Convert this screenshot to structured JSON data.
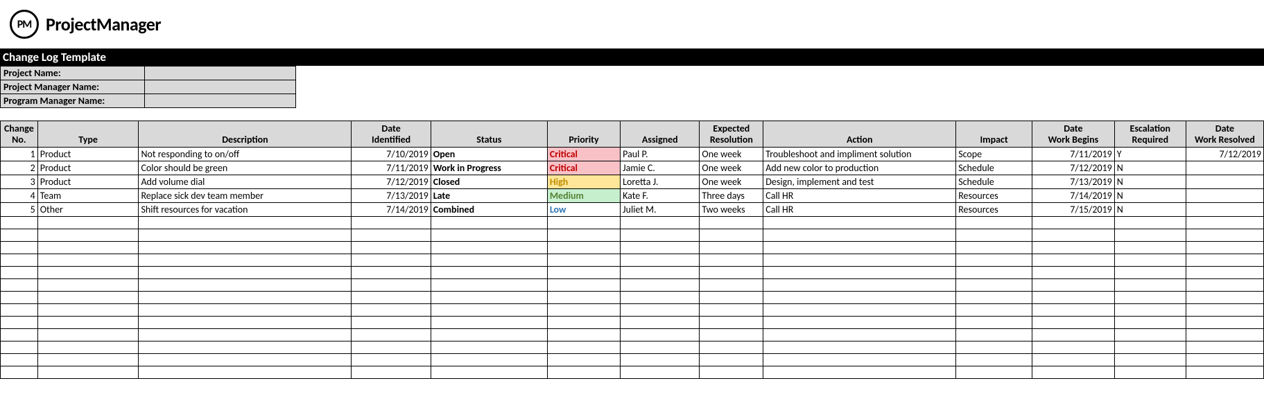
{
  "logo": {
    "badge": "PM",
    "text": "ProjectManager"
  },
  "titleBar": "Change Log Template",
  "meta": [
    {
      "label": "Project Name:",
      "value": ""
    },
    {
      "label": "Project Manager Name:",
      "value": ""
    },
    {
      "label": "Program Manager Name:",
      "value": ""
    }
  ],
  "columns": [
    "Change No.",
    "Type",
    "Description",
    "Date Identified",
    "Status",
    "Priority",
    "Assigned",
    "Expected Resolution",
    "Action",
    "Impact",
    "Date Work Begins",
    "Escalation Required",
    "Date Work Resolved"
  ],
  "rows": [
    {
      "no": "1",
      "type": "Product",
      "desc": "Not responding to on/off",
      "dateId": "7/10/2019",
      "status": "Open",
      "priority": "Critical",
      "assigned": "Paul P.",
      "expRes": "One week",
      "action": "Troubleshoot and impliment solution",
      "impact": "Scope",
      "dwb": "7/11/2019",
      "esc": "Y",
      "dwr": "7/12/2019"
    },
    {
      "no": "2",
      "type": "Product",
      "desc": "Color should be green",
      "dateId": "7/11/2019",
      "status": "Work in Progress",
      "priority": "Critical",
      "assigned": "Jamie C.",
      "expRes": "One week",
      "action": "Add new color to production",
      "impact": "Schedule",
      "dwb": "7/12/2019",
      "esc": "N",
      "dwr": ""
    },
    {
      "no": "3",
      "type": "Product",
      "desc": "Add volume dial",
      "dateId": "7/12/2019",
      "status": "Closed",
      "priority": "High",
      "assigned": "Loretta J.",
      "expRes": "One week",
      "action": "Design, implement and test",
      "impact": "Schedule",
      "dwb": "7/13/2019",
      "esc": "N",
      "dwr": ""
    },
    {
      "no": "4",
      "type": "Team",
      "desc": "Replace sick dev team member",
      "dateId": "7/13/2019",
      "status": "Late",
      "priority": "Medium",
      "assigned": "Kate F.",
      "expRes": "Three days",
      "action": "Call HR",
      "impact": "Resources",
      "dwb": "7/14/2019",
      "esc": "N",
      "dwr": ""
    },
    {
      "no": "5",
      "type": "Other",
      "desc": "Shift resources for vacation",
      "dateId": "7/14/2019",
      "status": "Combined",
      "priority": "Low",
      "assigned": "Juliet M.",
      "expRes": "Two weeks",
      "action": "Call HR",
      "impact": "Resources",
      "dwb": "7/15/2019",
      "esc": "N",
      "dwr": ""
    }
  ],
  "emptyRows": 13,
  "priorityStyles": {
    "Critical": "prio-critical",
    "High": "prio-high",
    "Medium": "prio-medium",
    "Low": "prio-low"
  }
}
